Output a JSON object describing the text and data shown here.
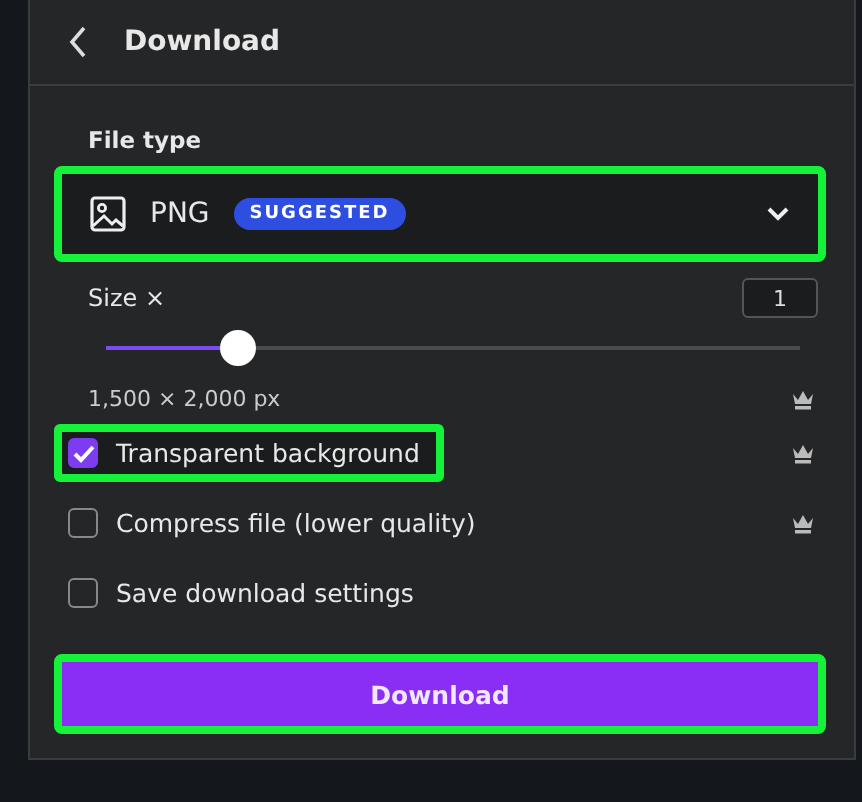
{
  "header": {
    "title": "Download"
  },
  "file_type": {
    "label": "File type",
    "value": "PNG",
    "badge": "SUGGESTED",
    "highlighted": true
  },
  "size": {
    "label": "Size ×",
    "value": "1",
    "level": 0.19,
    "dimensions": "1,500 × 2,000 px",
    "premium": true
  },
  "options": [
    {
      "label": "Transparent background",
      "checked": true,
      "premium": true,
      "highlighted": true
    },
    {
      "label": "Compress file (lower quality)",
      "checked": false,
      "premium": true,
      "highlighted": false
    },
    {
      "label": "Save download settings",
      "checked": false,
      "premium": false,
      "highlighted": false
    }
  ],
  "download_button": {
    "label": "Download",
    "highlighted": true
  }
}
